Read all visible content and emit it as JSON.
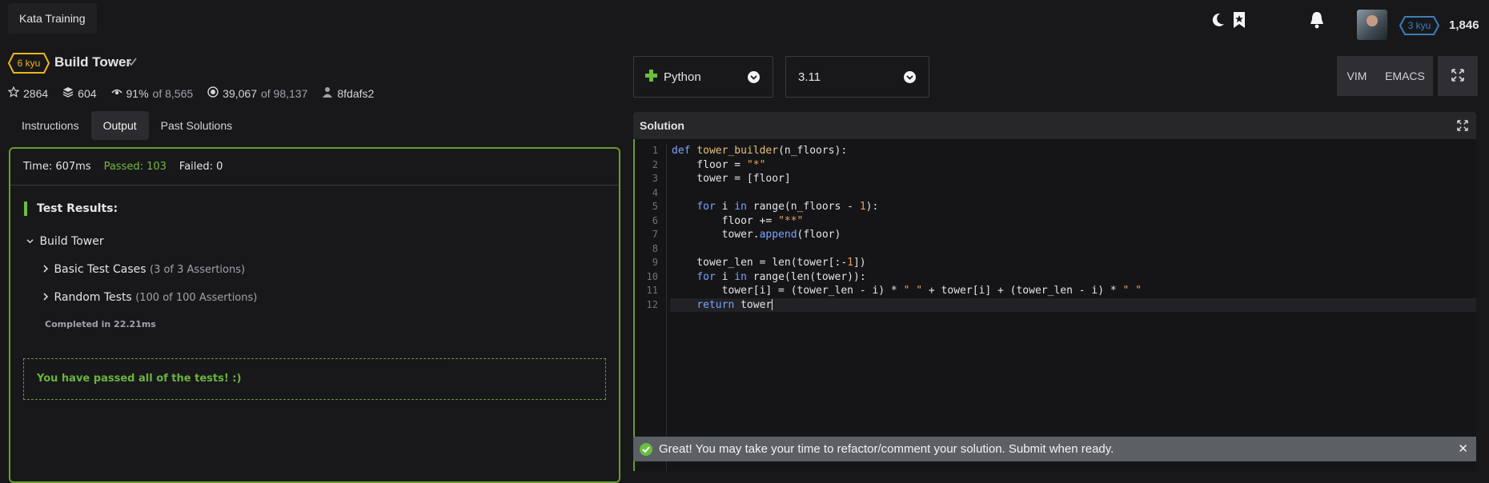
{
  "topbar": {
    "kata_training_label": "Kata Training",
    "user_rank": "3 kyu",
    "honor": "1,846"
  },
  "kata": {
    "rank": "6 kyu",
    "title": "Build Tower",
    "stars": "2864",
    "collections": "604",
    "satisfaction_pct": "91%",
    "satisfaction_of": "of 8,565",
    "completed": "39,067",
    "completed_of": "of 98,137",
    "author": "8fdafs2"
  },
  "tabs": [
    {
      "label": "Instructions"
    },
    {
      "label": "Output"
    },
    {
      "label": "Past Solutions"
    }
  ],
  "output": {
    "time": "Time: 607ms",
    "passed": "Passed: 103",
    "failed": "Failed: 0",
    "test_results_label": "Test Results:",
    "suite_name": "Build Tower",
    "cases": [
      {
        "name": "Basic Test Cases",
        "detail": "(3 of 3 Assertions)"
      },
      {
        "name": "Random Tests",
        "detail": "(100 of 100 Assertions)"
      }
    ],
    "completed_in": "Completed in 22.21ms",
    "pass_message": "You have passed all of the tests! :)"
  },
  "editor": {
    "language": "Python",
    "version": "3.11",
    "vim_label": "VIM",
    "emacs_label": "EMACS",
    "solution_label": "Solution",
    "line_numbers": [
      "1",
      "2",
      "3",
      "4",
      "5",
      "6",
      "7",
      "8",
      "9",
      "10",
      "11",
      "12"
    ]
  },
  "notification": {
    "message": "Great! You may take your time to refactor/comment your solution. Submit when ready."
  },
  "colors": {
    "accent_green": "#6a9a2d",
    "rank_yellow": "#ecb613",
    "rank_blue": "#3c7ebb"
  }
}
